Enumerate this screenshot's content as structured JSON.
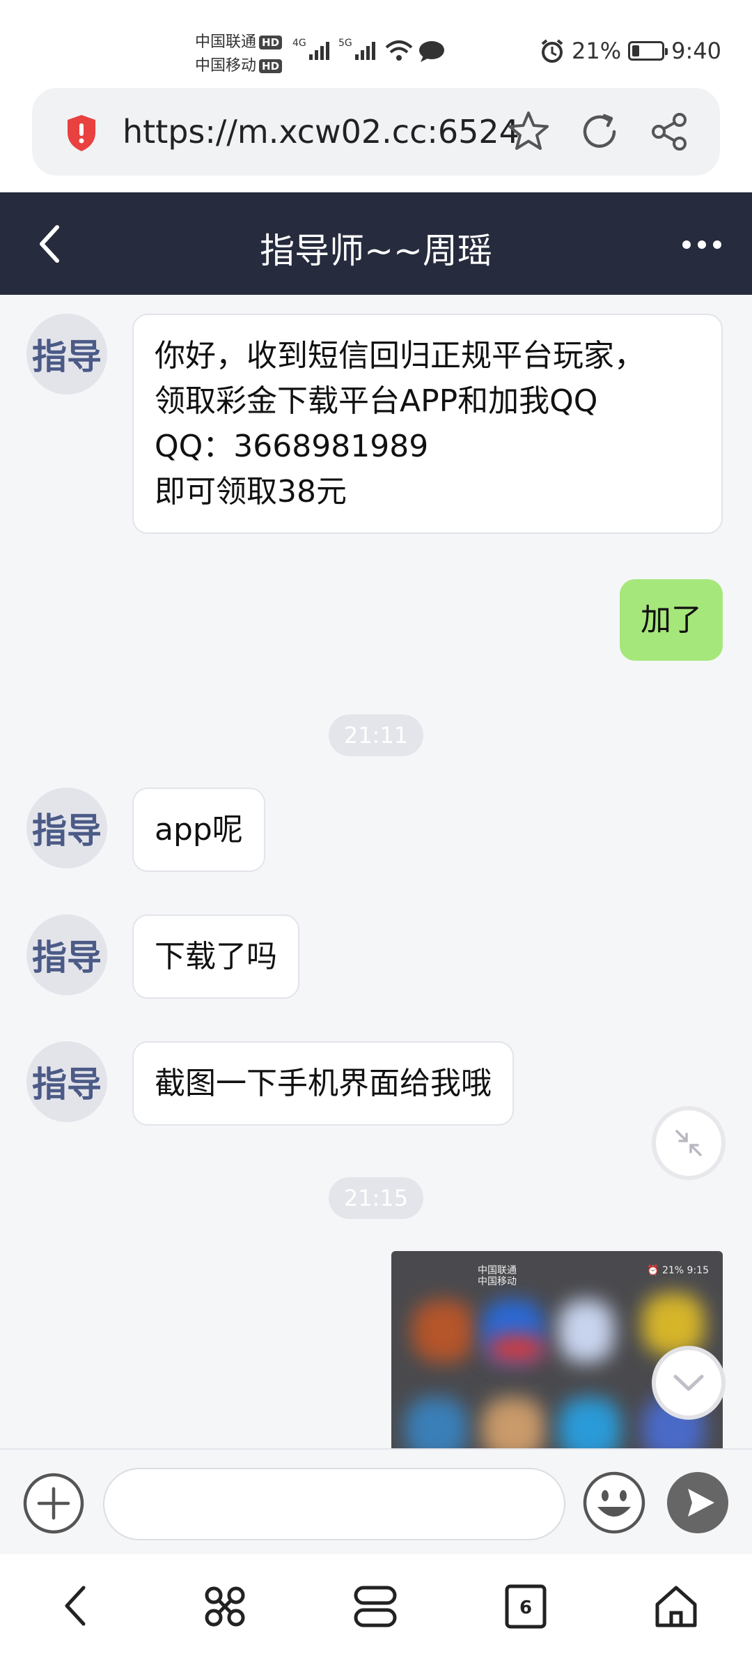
{
  "status_bar": {
    "carrier1": "中国联通",
    "carrier2": "中国移动",
    "hd": "HD",
    "network1": "4G",
    "network2": "5G",
    "battery": "21%",
    "time": "9:40"
  },
  "browser": {
    "url": "https://m.xcw02.cc:6524"
  },
  "chat": {
    "title": "指导师~~周瑶",
    "avatar_label": "指导",
    "messages": [
      {
        "text": "你好，收到短信回归正规平台玩家，\n领取彩金下载平台APP和加我QQ\nQQ：3668981989\n即可领取38元"
      },
      {
        "text": "加了"
      },
      {
        "text": "app呢"
      },
      {
        "text": "下载了吗"
      },
      {
        "text": "截图一下手机界面给我哦"
      }
    ],
    "timestamps": [
      "21:11",
      "21:15"
    ],
    "image_preview": {
      "carrier1": "中国联通",
      "carrier2": "中国移动",
      "status_right": "⏰ 21% 9:15"
    }
  },
  "input": {
    "placeholder": ""
  },
  "colors": {
    "header_bg": "#262b3d",
    "outgoing_bubble": "#a6e77b",
    "avatar_text": "#4b5a86",
    "shield_red": "#e8413f"
  },
  "nav": {
    "tab_count": "6"
  }
}
